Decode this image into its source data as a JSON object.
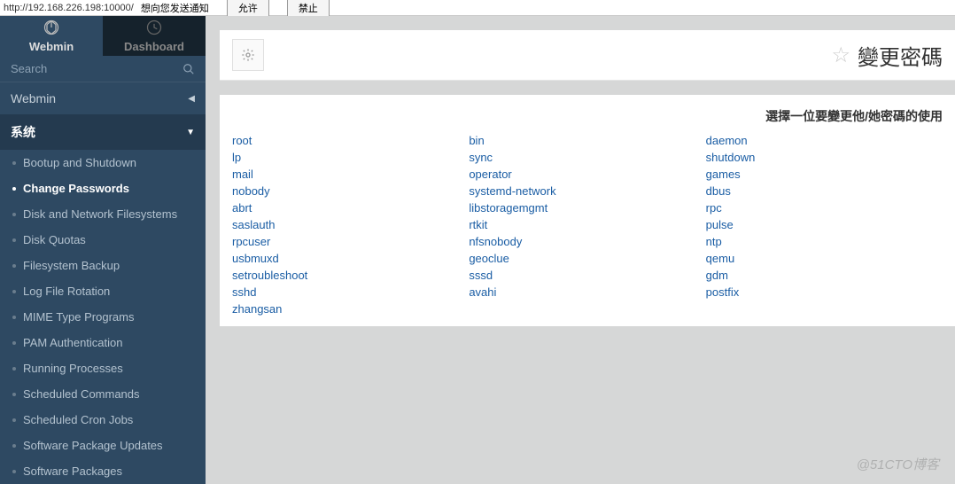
{
  "browser": {
    "url_prefix": "http://192.168.226.198:10000/",
    "prompt_text": "想向您发送通知",
    "allow_btn": "允许",
    "block_btn": "禁止"
  },
  "tabs": {
    "webmin": "Webmin",
    "dashboard": "Dashboard"
  },
  "search": {
    "placeholder": "Search"
  },
  "nav": {
    "webmin_section": "Webmin",
    "system_section": "系统",
    "items": [
      "Bootup and Shutdown",
      "Change Passwords",
      "Disk and Network Filesystems",
      "Disk Quotas",
      "Filesystem Backup",
      "Log File Rotation",
      "MIME Type Programs",
      "PAM Authentication",
      "Running Processes",
      "Scheduled Commands",
      "Scheduled Cron Jobs",
      "Software Package Updates",
      "Software Packages"
    ],
    "active_index": 1
  },
  "header": {
    "title": "變更密碼"
  },
  "content": {
    "heading": "選擇一位要變更他/她密碼的使用",
    "users": [
      [
        "root",
        "bin",
        "daemon"
      ],
      [
        "lp",
        "sync",
        "shutdown"
      ],
      [
        "mail",
        "operator",
        "games"
      ],
      [
        "nobody",
        "systemd-network",
        "dbus"
      ],
      [
        "abrt",
        "libstoragemgmt",
        "rpc"
      ],
      [
        "saslauth",
        "rtkit",
        "pulse"
      ],
      [
        "rpcuser",
        "nfsnobody",
        "ntp"
      ],
      [
        "usbmuxd",
        "geoclue",
        "qemu"
      ],
      [
        "setroubleshoot",
        "sssd",
        "gdm"
      ],
      [
        "sshd",
        "avahi",
        "postfix"
      ],
      [
        "zhangsan",
        "",
        ""
      ]
    ]
  },
  "watermark": "@51CTO博客"
}
